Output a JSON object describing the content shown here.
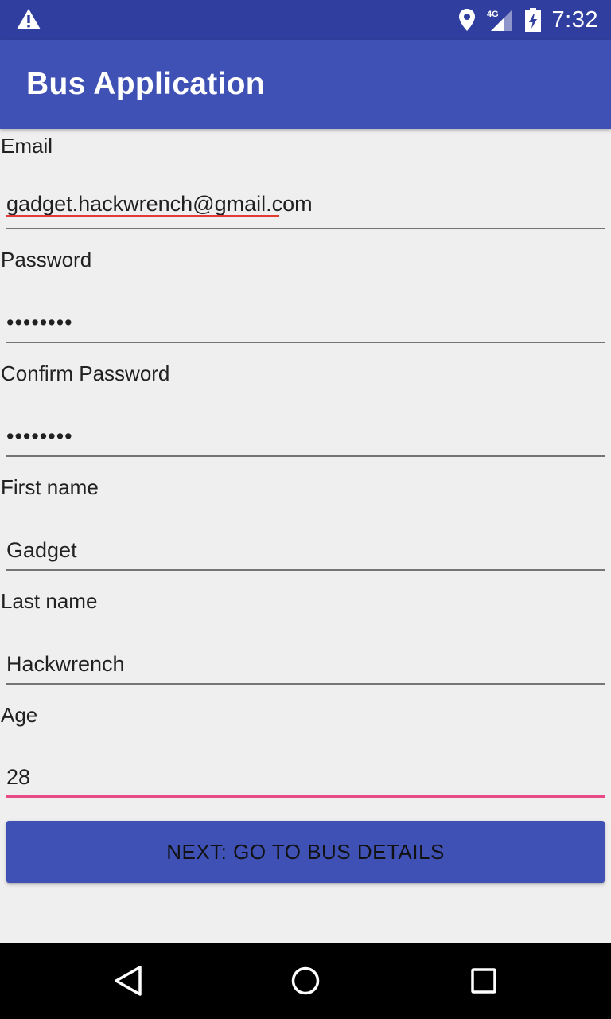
{
  "status_bar": {
    "time": "7:32",
    "network": "4G",
    "icons": [
      "warning-icon",
      "location-icon",
      "signal-icon",
      "battery-charging-icon"
    ]
  },
  "app_bar": {
    "title": "Bus Application"
  },
  "form": {
    "email": {
      "label": "Email",
      "value": "gadget.hackwrench@gmail.com"
    },
    "password": {
      "label": "Password",
      "value": "••••••••"
    },
    "confirm_password": {
      "label": "Confirm Password",
      "value": "••••••••"
    },
    "first_name": {
      "label": "First name",
      "value": "Gadget"
    },
    "last_name": {
      "label": "Last name",
      "value": "Hackwrench"
    },
    "age": {
      "label": "Age",
      "value": "28"
    }
  },
  "next_button": {
    "label": "NEXT: GO TO BUS DETAILS"
  },
  "nav_bar": {
    "icons": [
      "back-icon",
      "home-icon",
      "recents-icon"
    ]
  },
  "colors": {
    "primary": "#3f51b5",
    "primary_dark": "#303f9f",
    "accent": "#e84a86",
    "background": "#efefef"
  }
}
